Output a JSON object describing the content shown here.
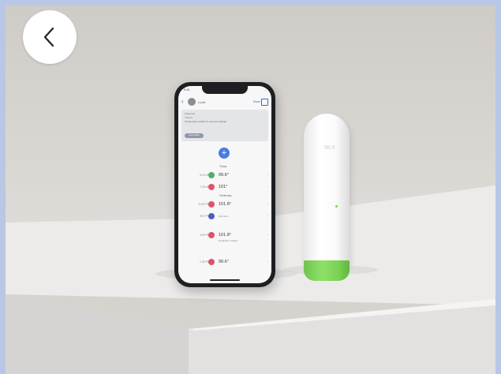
{
  "nav": {
    "back_icon": "chevron-left-icon"
  },
  "photo": {
    "colors": {
      "wall": "#d2cfcb",
      "table": "#ecebea",
      "thermometer_band": "#7ad255",
      "phone_accent": "#4a7be0"
    },
    "phone_screen": {
      "status": {
        "time": "9:41",
        "signals": "..."
      },
      "header": {
        "name": "Lucie",
        "share": "Share",
        "calendar_icon": "calendar-icon"
      },
      "notice": {
        "line1": "Diagnosis",
        "line2": "Thermo",
        "body": "Temperature stable for several readings",
        "button": "View details"
      },
      "readings": [
        {
          "time": "9:24 AM",
          "value": "99.6°",
          "color": "#4fb06a"
        },
        {
          "time": "7:33 AM",
          "value": "101°",
          "color": "#e0526a"
        },
        {
          "time": "11:00 PM",
          "value": "101.8°",
          "color": "#e0526a"
        },
        {
          "time": "8:37 PM",
          "value": "",
          "sub": "Ibuprofen",
          "color": "#4a5ec8"
        },
        {
          "time": "4:09 PM",
          "value": "101.8°",
          "sub": "Headache, fatigue",
          "color": "#e0526a"
        },
        {
          "time": "1:30 PM",
          "value": "99.6°",
          "color": "#e0526a"
        }
      ],
      "sections": {
        "today": "Today",
        "yesterday": "Yesterday"
      }
    },
    "thermometer_display": "98.6"
  }
}
